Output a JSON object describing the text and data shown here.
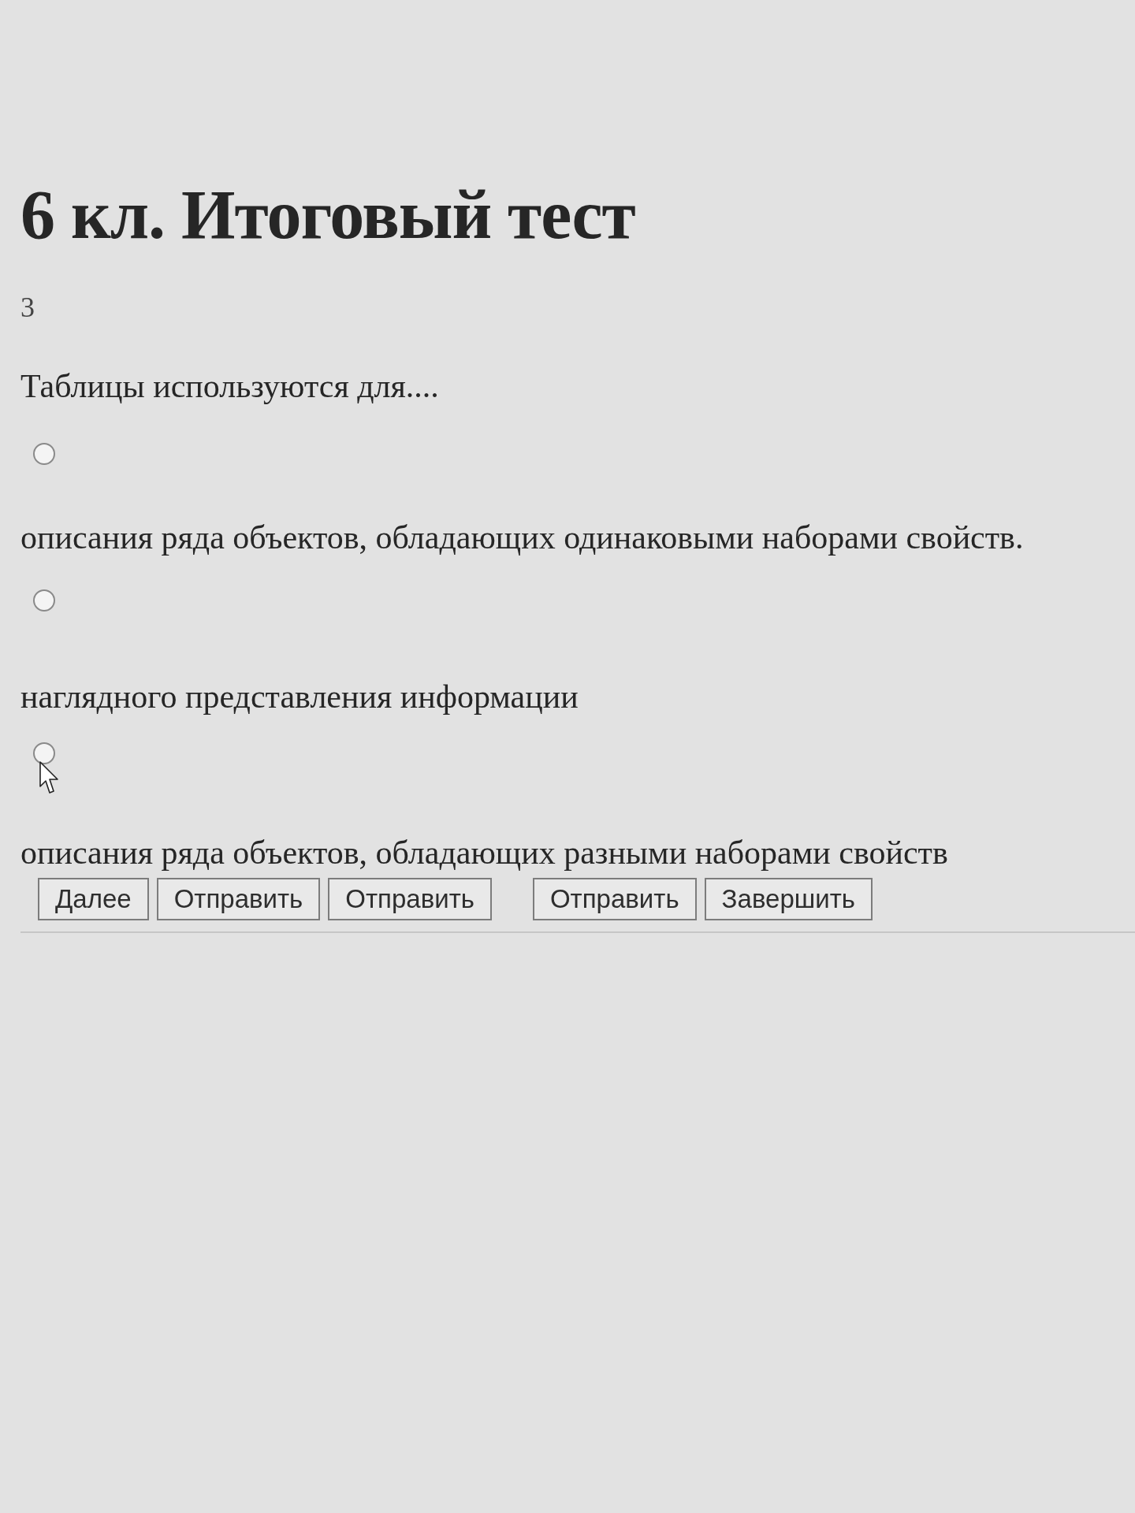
{
  "test": {
    "title": "6 кл. Итоговый тест",
    "question_number": "3",
    "question": "Таблицы используются для....",
    "options": [
      {
        "label": "описания ряда объектов, обладающих одинаковыми наборами свойств.",
        "selected": false
      },
      {
        "label": "наглядного представления информации",
        "selected": false
      },
      {
        "label": "описания ряда объектов, обладающих разными наборами свойств",
        "selected": false,
        "pointer": true
      }
    ],
    "button_groups": [
      {
        "buttons": [
          {
            "label": "Далее"
          },
          {
            "label": "Отправить"
          },
          {
            "label": "Отправить"
          }
        ]
      },
      {
        "buttons": [
          {
            "label": "Отправить"
          },
          {
            "label": "Завершить"
          }
        ]
      }
    ]
  }
}
